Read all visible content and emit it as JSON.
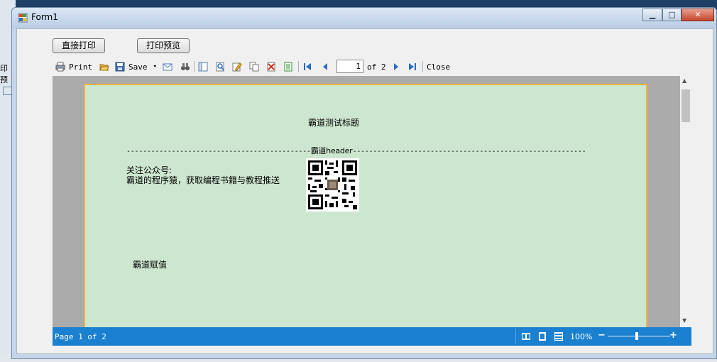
{
  "window": {
    "title": "Form1",
    "minimize_glyph": "▁",
    "maximize_glyph": "□",
    "close_glyph": "✕"
  },
  "buttons": {
    "direct_print": "直接打印",
    "print_preview": "打印预览"
  },
  "toolbar": {
    "print_label": "Print",
    "save_label": "Save",
    "save_dropdown_glyph": "▾",
    "page_value": "1",
    "of_label": "of 2",
    "close_label": "Close"
  },
  "report": {
    "title": "霸道测试标题",
    "header_text": "霸道header",
    "dash_left": "---------------------------------------------",
    "dash_right": "---------------------------------------------------------",
    "follow_line1": "关注公众号:",
    "follow_line2": "霸道的程序猿，获取编程书籍与教程推送",
    "assign_text": "霸道赋值"
  },
  "statusbar": {
    "page_text": "Page 1 of 2",
    "zoom": "100%",
    "minus": "−",
    "plus": "+"
  },
  "scrollbar": {
    "up": "▲",
    "down": "▼"
  },
  "background": {
    "left_text": "印预"
  },
  "colors": {
    "paper": "#cde6cf",
    "status": "#1b80d0",
    "border_accent": "#f0b43c"
  }
}
